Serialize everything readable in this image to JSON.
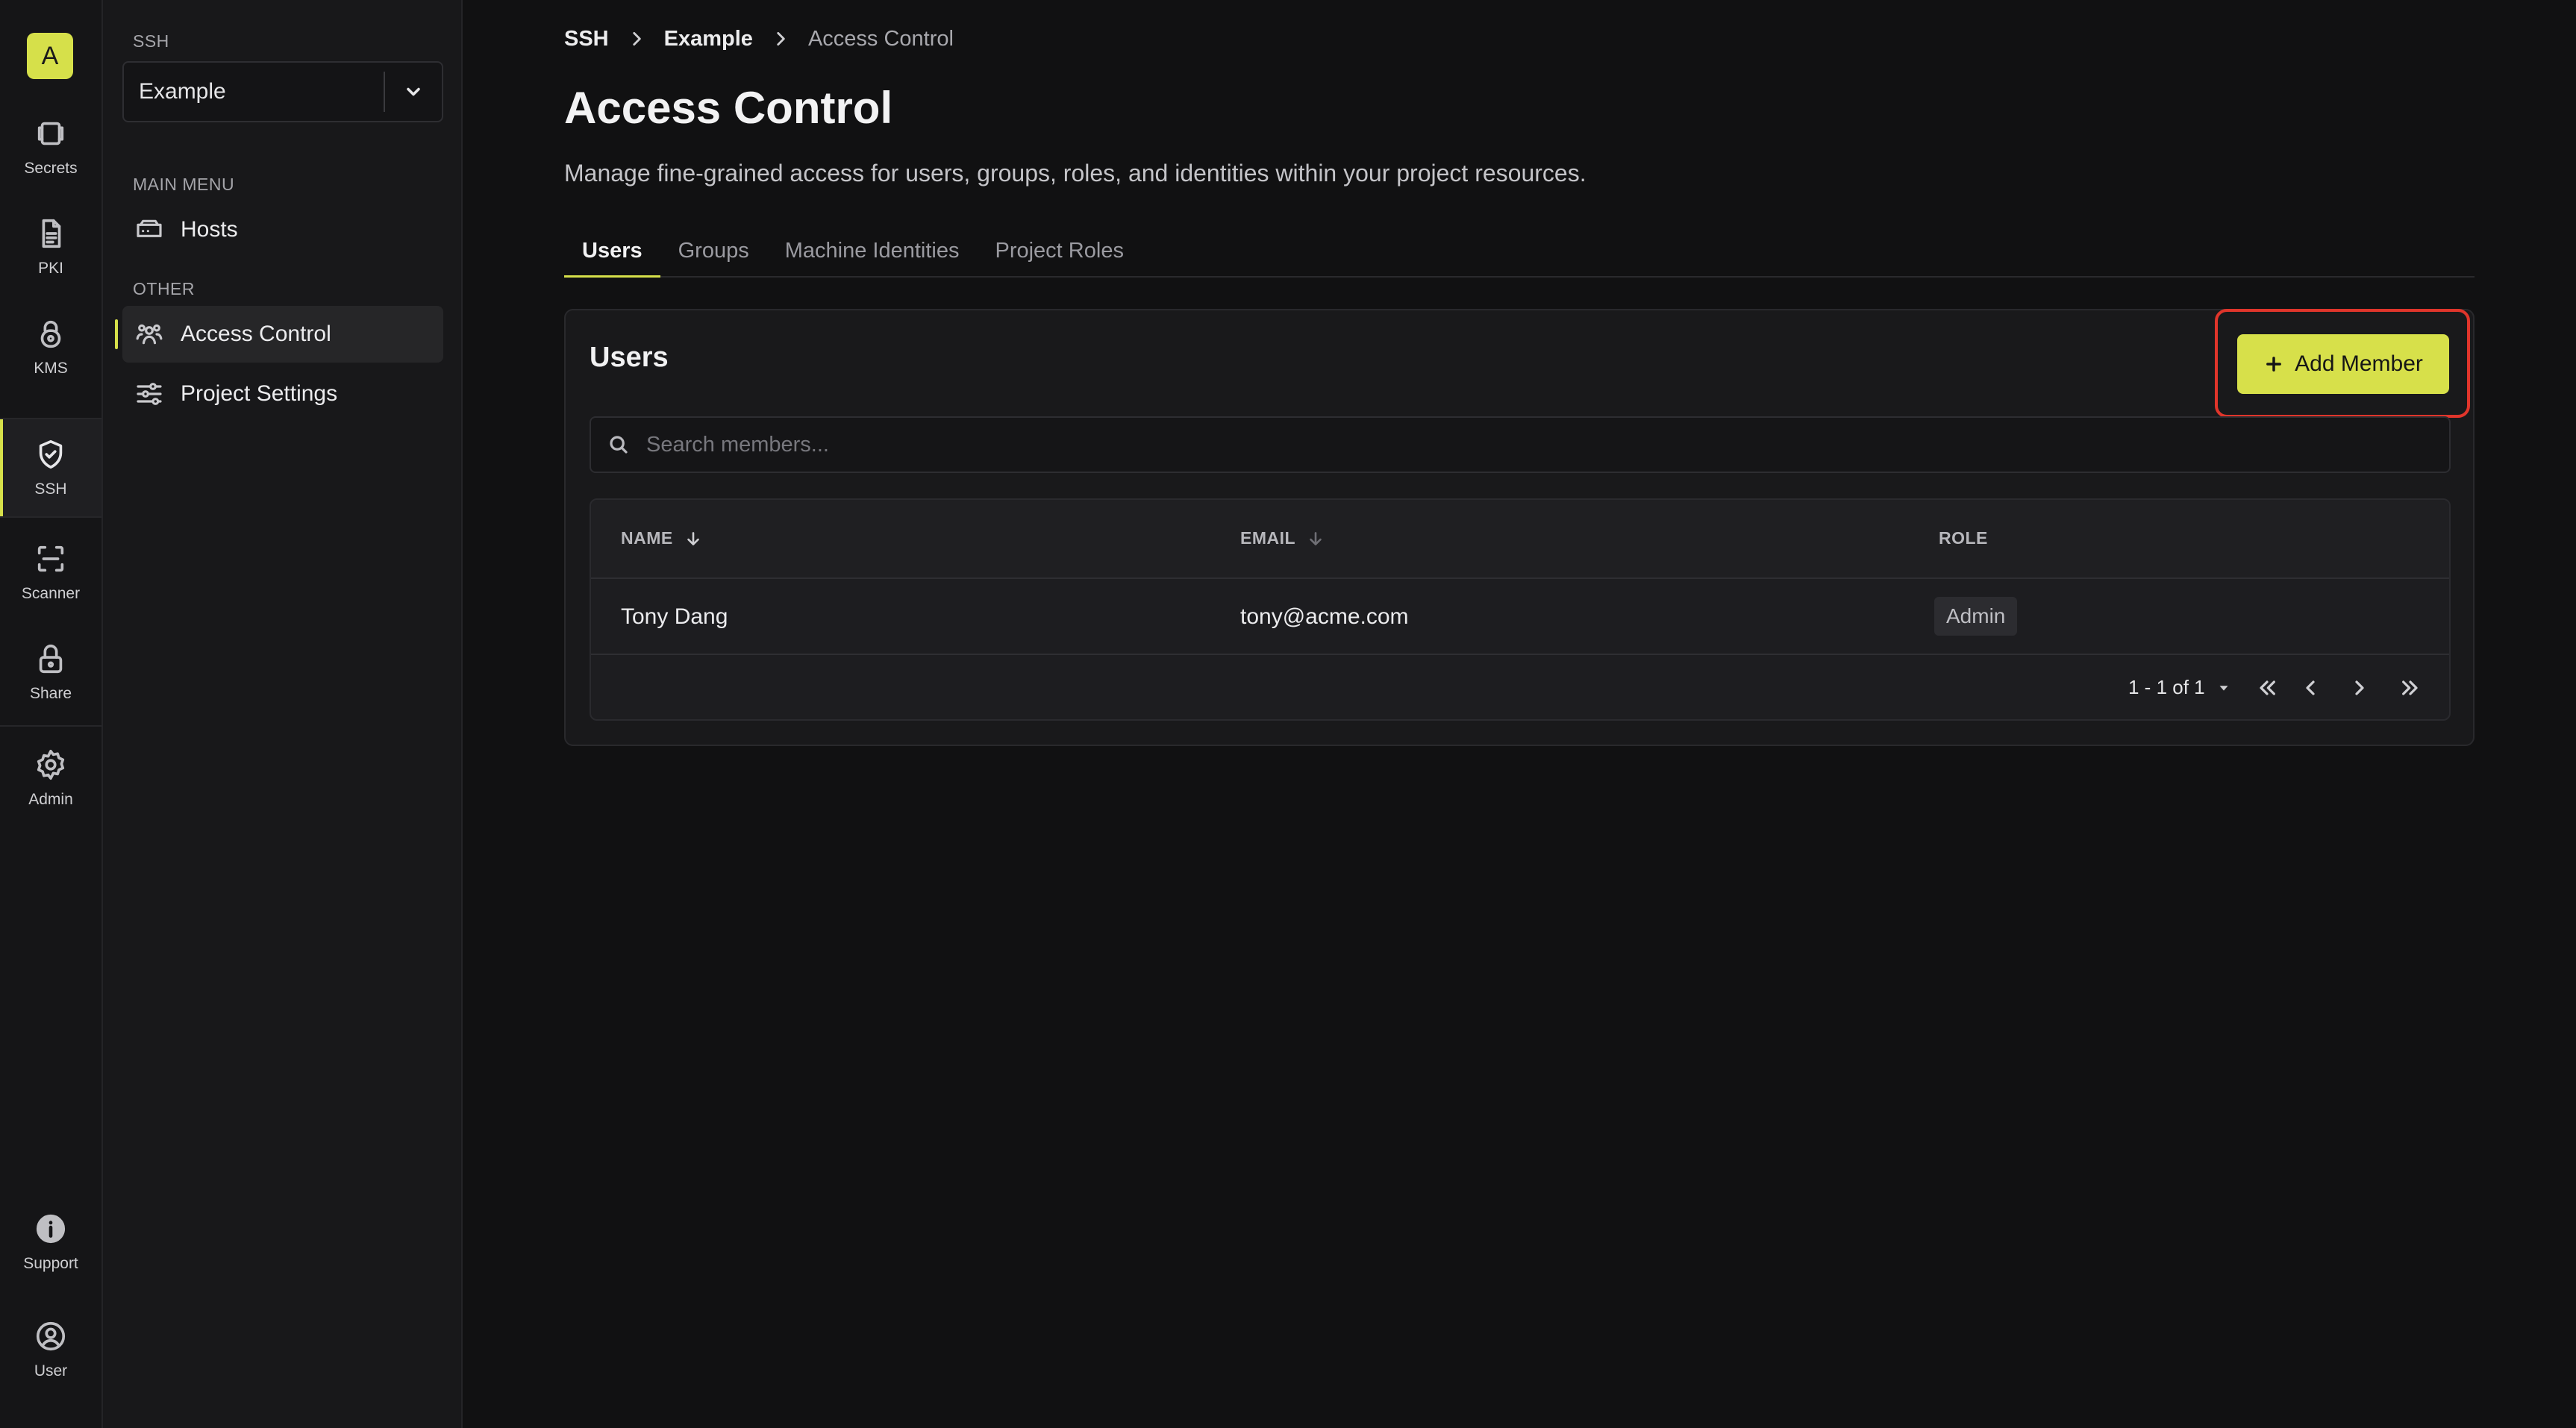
{
  "org": {
    "initial": "A"
  },
  "rail": {
    "items": [
      {
        "label": "Secrets",
        "icon": "secrets-icon"
      },
      {
        "label": "PKI",
        "icon": "pki-icon"
      },
      {
        "label": "KMS",
        "icon": "kms-icon"
      },
      {
        "label": "SSH",
        "icon": "ssh-icon",
        "active": true
      },
      {
        "label": "Scanner",
        "icon": "scanner-icon"
      },
      {
        "label": "Share",
        "icon": "lock-icon"
      },
      {
        "label": "Admin",
        "icon": "gear-icon"
      },
      {
        "label": "Support",
        "icon": "info-icon"
      },
      {
        "label": "User",
        "icon": "user-icon"
      }
    ]
  },
  "sidebar": {
    "section_product": "SSH",
    "project_selector": {
      "value": "Example"
    },
    "main_menu_label": "MAIN MENU",
    "main_menu": [
      {
        "label": "Hosts",
        "icon": "hosts-icon"
      }
    ],
    "other_label": "OTHER",
    "other": [
      {
        "label": "Access Control",
        "icon": "users-icon",
        "active": true
      },
      {
        "label": "Project Settings",
        "icon": "sliders-icon"
      }
    ]
  },
  "breadcrumb": [
    "SSH",
    "Example",
    "Access Control"
  ],
  "page": {
    "title": "Access Control",
    "description": "Manage fine-grained access for users, groups, roles, and identities within your project resources."
  },
  "tabs": [
    {
      "label": "Users",
      "active": true
    },
    {
      "label": "Groups"
    },
    {
      "label": "Machine Identities"
    },
    {
      "label": "Project Roles"
    }
  ],
  "users_card": {
    "title": "Users",
    "add_button": "Add Member",
    "search_placeholder": "Search members...",
    "columns": {
      "name": "NAME",
      "email": "EMAIL",
      "role": "ROLE"
    },
    "rows": [
      {
        "name": "Tony Dang",
        "email": "tony@acme.com",
        "role": "Admin"
      }
    ],
    "pagination": {
      "range": "1 - 1 of 1"
    }
  },
  "colors": {
    "accent": "#d7e04a",
    "highlight": "#e0352b",
    "background": "#111112"
  }
}
